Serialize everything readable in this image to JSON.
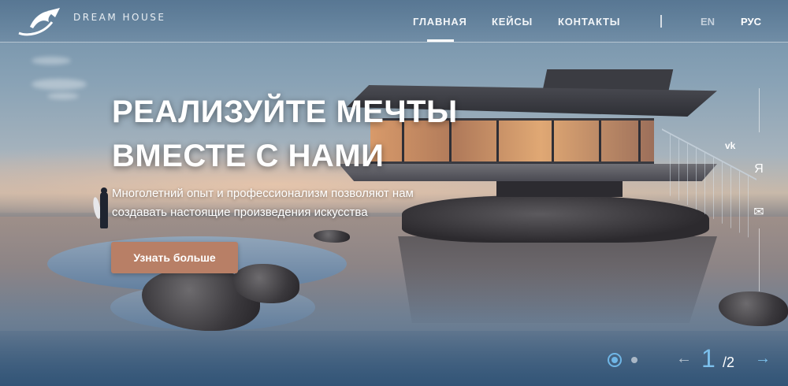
{
  "brand": {
    "name": "DREAM HOUSE",
    "logo_icon": "wave-logo-icon"
  },
  "nav": {
    "items": [
      {
        "label": "ГЛАВНАЯ",
        "active": true
      },
      {
        "label": "КЕЙСЫ",
        "active": false
      },
      {
        "label": "КОНТАКТЫ",
        "active": false
      }
    ],
    "languages": [
      {
        "label": "EN",
        "active": false
      },
      {
        "label": "РУС",
        "active": true
      }
    ]
  },
  "hero": {
    "title_line1": "РЕАЛИЗУЙТЕ МЕЧТЫ",
    "title_line2": "ВМЕСТЕ С НАМИ",
    "subtitle": "Многолетний опыт и профессионализм позволяют нам создавать настоящие произведения искусства",
    "cta_label": "Узнать больше"
  },
  "social": [
    {
      "icon": "vk-icon",
      "glyph": "vk"
    },
    {
      "icon": "yandex-icon",
      "glyph": "Я"
    },
    {
      "icon": "mail-icon",
      "glyph": "✉"
    }
  ],
  "pager": {
    "current": "1",
    "total": "/2",
    "prev_glyph": "←",
    "next_glyph": "→"
  },
  "colors": {
    "accent_button": "#b87f66",
    "pager_accent": "#7cc0ec",
    "lang_inactive": "#c4d0dc"
  }
}
